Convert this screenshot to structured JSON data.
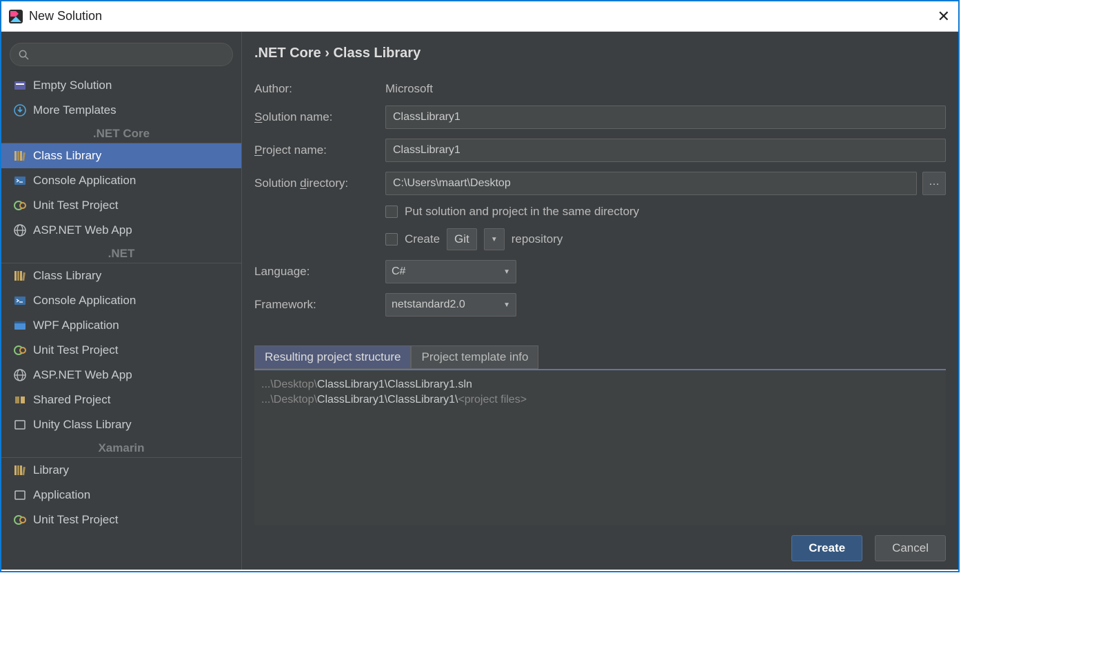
{
  "window": {
    "title": "New Solution"
  },
  "sidebar": {
    "search_placeholder": "",
    "top_items": [
      {
        "label": "Empty Solution"
      },
      {
        "label": "More Templates"
      }
    ],
    "groups": [
      {
        "header": ".NET Core",
        "items": [
          {
            "label": "Class Library",
            "selected": true,
            "icon": "books"
          },
          {
            "label": "Console Application",
            "icon": "console"
          },
          {
            "label": "Unit Test Project",
            "icon": "test"
          },
          {
            "label": "ASP.NET Web App",
            "icon": "web"
          }
        ]
      },
      {
        "header": ".NET",
        "items": [
          {
            "label": "Class Library",
            "icon": "books"
          },
          {
            "label": "Console Application",
            "icon": "console"
          },
          {
            "label": "WPF Application",
            "icon": "wpf"
          },
          {
            "label": "Unit Test Project",
            "icon": "test"
          },
          {
            "label": "ASP.NET Web App",
            "icon": "web"
          },
          {
            "label": "Shared Project",
            "icon": "shared"
          },
          {
            "label": "Unity Class Library",
            "icon": "unity"
          }
        ]
      },
      {
        "header": "Xamarin",
        "items": [
          {
            "label": "Library",
            "icon": "books"
          },
          {
            "label": "Application",
            "icon": "app"
          },
          {
            "label": "Unit Test Project",
            "icon": "test"
          }
        ]
      }
    ]
  },
  "breadcrumb": {
    "category": ".NET Core",
    "template": "Class Library"
  },
  "form": {
    "author_label": "Author:",
    "author_value": "Microsoft",
    "solution_name_label_pre": "S",
    "solution_name_label_post": "olution name:",
    "solution_name": "ClassLibrary1",
    "project_name_label_pre": "P",
    "project_name_label_post": "roject name:",
    "project_name": "ClassLibrary1",
    "solution_dir_label_pre": "Solution ",
    "solution_dir_label_u": "d",
    "solution_dir_label_post": "irectory:",
    "solution_dir": "C:\\Users\\maart\\Desktop",
    "same_dir_label": "Put solution and project in the same directory",
    "create_repo_pre": "Create",
    "create_repo_type": "Git",
    "create_repo_post": "repository",
    "language_label": "Language:",
    "language_value": "C#",
    "framework_label": "Framework:",
    "framework_value": "netstandard2.0"
  },
  "tabs": {
    "structure": "Resulting project structure",
    "info": "Project template info"
  },
  "structure": {
    "line1_dim": "...\\Desktop\\",
    "line1_bright": "ClassLibrary1\\ClassLibrary1.sln",
    "line2_dim1": "...\\Desktop\\",
    "line2_bright": "ClassLibrary1\\ClassLibrary1\\",
    "line2_dim2": "<project files>"
  },
  "buttons": {
    "create": "Create",
    "cancel": "Cancel"
  }
}
